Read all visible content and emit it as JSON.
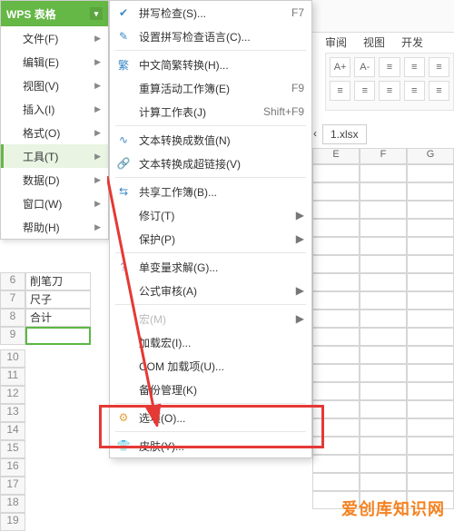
{
  "app": {
    "title": "WPS 表格"
  },
  "mainmenu": {
    "items": [
      {
        "label": "文件(F)"
      },
      {
        "label": "编辑(E)"
      },
      {
        "label": "视图(V)"
      },
      {
        "label": "插入(I)"
      },
      {
        "label": "格式(O)"
      },
      {
        "label": "工具(T)",
        "selected": true
      },
      {
        "label": "数据(D)"
      },
      {
        "label": "窗口(W)"
      },
      {
        "label": "帮助(H)"
      }
    ]
  },
  "submenu": {
    "items": [
      {
        "icon": "✔",
        "iconClass": "blue",
        "label": "拼写检查(S)...",
        "shortcut": "F7"
      },
      {
        "icon": "✎",
        "iconClass": "blue",
        "label": "设置拼写检查语言(C)...",
        "shortcut": ""
      },
      {
        "sep": true
      },
      {
        "icon": "繁",
        "iconClass": "blue",
        "label": "中文简繁转换(H)...",
        "shortcut": ""
      },
      {
        "icon": "",
        "iconClass": "",
        "label": "重算活动工作簿(E)",
        "shortcut": "F9"
      },
      {
        "icon": "",
        "iconClass": "",
        "label": "计算工作表(J)",
        "shortcut": "Shift+F9"
      },
      {
        "sep": true
      },
      {
        "icon": "∿",
        "iconClass": "blue",
        "label": "文本转换成数值(N)",
        "shortcut": ""
      },
      {
        "icon": "🔗",
        "iconClass": "blue",
        "label": "文本转换成超链接(V)",
        "shortcut": ""
      },
      {
        "sep": true
      },
      {
        "icon": "⇆",
        "iconClass": "blue",
        "label": "共享工作簿(B)...",
        "shortcut": ""
      },
      {
        "icon": "",
        "iconClass": "",
        "label": "修订(T)",
        "shortcut": "",
        "submenu": true
      },
      {
        "icon": "",
        "iconClass": "",
        "label": "保护(P)",
        "shortcut": "",
        "submenu": true
      },
      {
        "sep": true
      },
      {
        "icon": "?",
        "iconClass": "purple",
        "label": "单变量求解(G)...",
        "shortcut": ""
      },
      {
        "icon": "",
        "iconClass": "",
        "label": "公式审核(A)",
        "shortcut": "",
        "submenu": true
      },
      {
        "sep": true
      },
      {
        "icon": "",
        "iconClass": "",
        "label": "宏(M)",
        "shortcut": "",
        "submenu": true,
        "disabled": true
      },
      {
        "icon": "",
        "iconClass": "",
        "label": "加载宏(I)...",
        "shortcut": ""
      },
      {
        "icon": "",
        "iconClass": "",
        "label": "COM 加载项(U)...",
        "shortcut": ""
      },
      {
        "icon": "",
        "iconClass": "",
        "label": "备份管理(K)",
        "shortcut": ""
      },
      {
        "sep": true
      },
      {
        "icon": "⚙",
        "iconClass": "orange",
        "label": "选项(O)...",
        "shortcut": ""
      },
      {
        "sep": true
      },
      {
        "icon": "👕",
        "iconClass": "blue",
        "label": "皮肤(Y)...",
        "shortcut": ""
      }
    ]
  },
  "ribbon": {
    "tabs": [
      "审阅",
      "视图",
      "开发"
    ],
    "fontControls": {
      "increase": "A+",
      "decrease": "A-"
    },
    "alignTop": [
      "≡",
      "≡",
      "≡"
    ],
    "alignBottom": [
      "≡",
      "≡",
      "≡"
    ]
  },
  "workbook": {
    "filename": "1.xlsx",
    "colHeads": [
      "E",
      "F",
      "G"
    ],
    "rowNums": [
      6,
      7,
      8,
      9,
      10,
      11,
      12,
      13,
      14,
      15,
      16,
      17,
      18,
      19
    ],
    "leftCells": {
      "6": "削笔刀",
      "7": "尺子",
      "8": "合计",
      "9": ""
    }
  },
  "watermark": "爱创库知识网"
}
